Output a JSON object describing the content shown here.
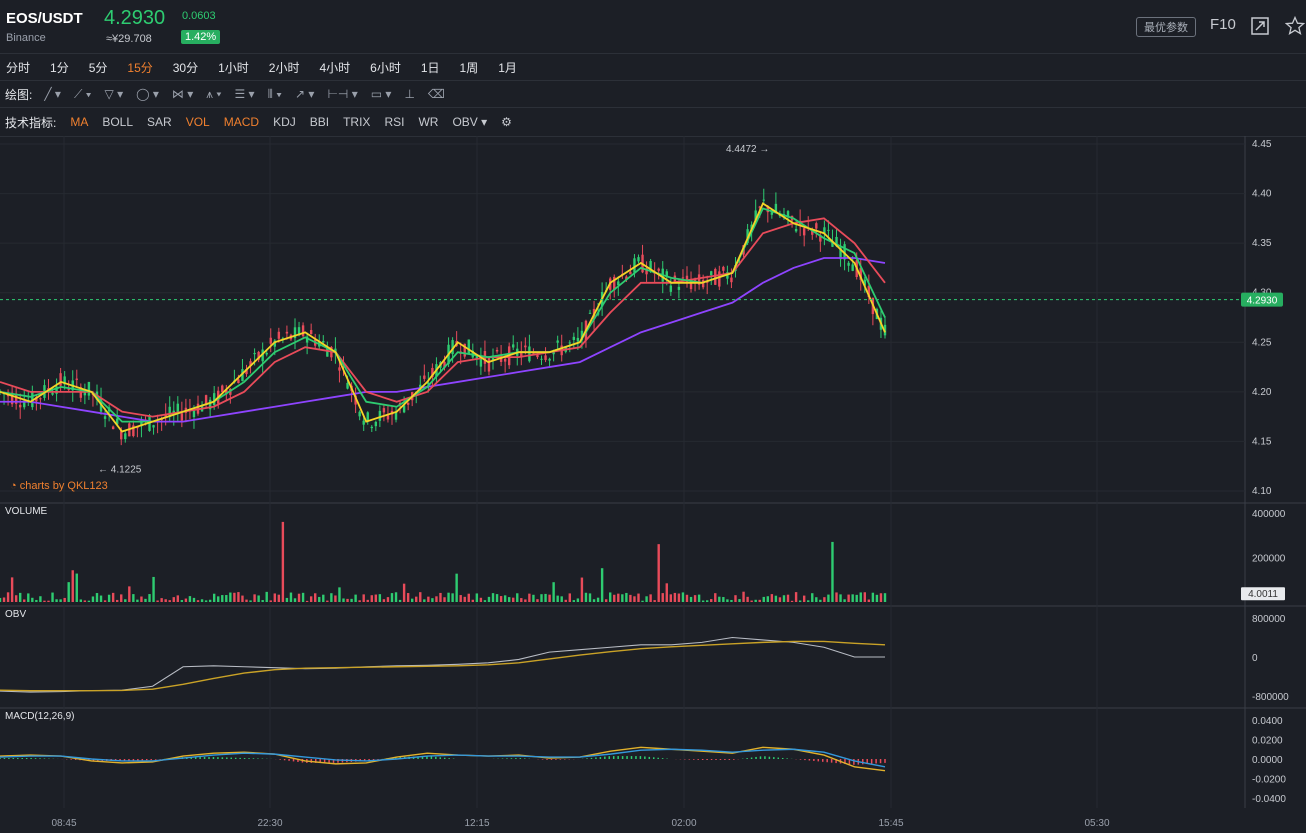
{
  "header": {
    "pair": "EOS/USDT",
    "exchange": "Binance",
    "price": "4.2930",
    "cny_price": "≈¥29.708",
    "change": "0.0603",
    "change_pct": "1.42%",
    "param_button": "最优参数",
    "f10": "F10",
    "colors": {
      "up": "#2ecc71",
      "down": "#e84b5a",
      "accent": "#f0802f"
    }
  },
  "timeframes": {
    "items": [
      "分时",
      "1分",
      "5分",
      "15分",
      "30分",
      "1小时",
      "2小时",
      "4小时",
      "6小时",
      "1日",
      "1周",
      "1月"
    ],
    "active": "15分"
  },
  "drawing": {
    "label": "绘图:",
    "tools": [
      "line-tool-icon",
      "fib-tool-icon",
      "channel-tool-icon",
      "circle-tool-icon",
      "pattern-tool-icon",
      "pitchfork-tool-icon",
      "gann-tool-icon",
      "bars-tool-icon",
      "arrow-tool-icon",
      "range-tool-icon",
      "comment-tool-icon",
      "measure-tool-icon",
      "trash-icon"
    ]
  },
  "indicators": {
    "label": "技术指标:",
    "items": [
      "MA",
      "BOLL",
      "SAR",
      "VOL",
      "MACD",
      "KDJ",
      "BBI",
      "TRIX",
      "RSI",
      "WR",
      "OBV"
    ],
    "active": [
      "MA",
      "VOL",
      "MACD"
    ]
  },
  "brand": "charts by QKL123",
  "chart_data": [
    {
      "type": "candlestick",
      "name": "price",
      "ylim": [
        4.1,
        4.45
      ],
      "yticks": [
        "4.45",
        "4.40",
        "4.35",
        "4.30",
        "4.25",
        "4.20",
        "4.15",
        "4.10"
      ],
      "last_price_label": "4.2930",
      "high_label": "4.4472",
      "low_label": "4.1225",
      "ma_colors": [
        "#f5d327",
        "#2ecc71",
        "#e84b5a",
        "#8e44ff"
      ],
      "ma_series": {
        "ma1": [
          4.2,
          4.19,
          4.21,
          4.2,
          4.16,
          4.17,
          4.18,
          4.19,
          4.22,
          4.25,
          4.26,
          4.24,
          4.17,
          4.18,
          4.21,
          4.25,
          4.23,
          4.24,
          4.24,
          4.25,
          4.31,
          4.33,
          4.31,
          4.31,
          4.32,
          4.39,
          4.37,
          4.36,
          4.33,
          4.26
        ],
        "ma2": [
          4.2,
          4.195,
          4.205,
          4.2,
          4.17,
          4.17,
          4.18,
          4.19,
          4.21,
          4.24,
          4.255,
          4.24,
          4.19,
          4.185,
          4.205,
          4.24,
          4.235,
          4.24,
          4.24,
          4.25,
          4.3,
          4.325,
          4.315,
          4.31,
          4.32,
          4.385,
          4.375,
          4.355,
          4.34,
          4.275
        ],
        "ma3": [
          4.21,
          4.2,
          4.2,
          4.2,
          4.18,
          4.175,
          4.18,
          4.185,
          4.2,
          4.23,
          4.245,
          4.24,
          4.2,
          4.19,
          4.2,
          4.23,
          4.235,
          4.235,
          4.24,
          4.245,
          4.28,
          4.31,
          4.31,
          4.315,
          4.32,
          4.36,
          4.37,
          4.375,
          4.35,
          4.31
        ],
        "ma4": [
          4.19,
          4.19,
          4.185,
          4.18,
          4.175,
          4.17,
          4.17,
          4.175,
          4.18,
          4.185,
          4.19,
          4.195,
          4.2,
          4.2,
          4.205,
          4.21,
          4.215,
          4.22,
          4.225,
          4.23,
          4.245,
          4.26,
          4.27,
          4.28,
          4.29,
          4.31,
          4.325,
          4.335,
          4.335,
          4.33
        ]
      },
      "x_labels": [
        "08:45",
        "22:30",
        "12:15",
        "02:00",
        "15:45",
        "05:30"
      ]
    },
    {
      "type": "bar",
      "name": "VOLUME",
      "ylim": [
        0,
        400000
      ],
      "yticks": [
        "400000",
        "200000"
      ],
      "last_label": "4.0011"
    },
    {
      "type": "line",
      "name": "OBV",
      "ylim": [
        -800000,
        800000
      ],
      "yticks": [
        "800000",
        "0",
        "-800000"
      ],
      "obv": [
        -700000,
        -720000,
        -710000,
        -690000,
        -680000,
        -600000,
        -200000,
        -180000,
        -200000,
        -220000,
        -240000,
        -230000,
        -200000,
        -180000,
        -170000,
        -150000,
        -120000,
        -50000,
        100000,
        150000,
        200000,
        250000,
        250000,
        300000,
        400000,
        350000,
        300000,
        200000,
        0,
        0
      ],
      "obv_ma": [
        -680000,
        -690000,
        -690000,
        -690000,
        -685000,
        -660000,
        -560000,
        -440000,
        -330000,
        -260000,
        -230000,
        -220000,
        -210000,
        -200000,
        -190000,
        -180000,
        -160000,
        -120000,
        -40000,
        40000,
        110000,
        170000,
        210000,
        240000,
        270000,
        300000,
        320000,
        320000,
        280000,
        250000
      ]
    },
    {
      "type": "line",
      "name": "MACD(12,26,9)",
      "ylim": [
        -0.04,
        0.04
      ],
      "yticks": [
        "0.0400",
        "0.0200",
        "0.0000",
        "-0.0200",
        "-0.0400"
      ],
      "dif": [
        0.003,
        0.004,
        0.003,
        -0.002,
        -0.004,
        -0.003,
        0.003,
        0.006,
        0.007,
        0.005,
        -0.002,
        -0.005,
        -0.004,
        0.002,
        0.006,
        0.004,
        0.003,
        0.004,
        0.001,
        0.002,
        0.008,
        0.012,
        0.01,
        0.008,
        0.006,
        0.012,
        0.01,
        0.004,
        -0.008,
        -0.012
      ],
      "dea": [
        0.002,
        0.003,
        0.003,
        0.0,
        -0.002,
        -0.002,
        0.001,
        0.004,
        0.006,
        0.005,
        0.002,
        -0.001,
        -0.002,
        0.0,
        0.003,
        0.004,
        0.003,
        0.003,
        0.002,
        0.002,
        0.005,
        0.009,
        0.01,
        0.009,
        0.007,
        0.009,
        0.01,
        0.007,
        -0.002,
        -0.008
      ]
    }
  ]
}
